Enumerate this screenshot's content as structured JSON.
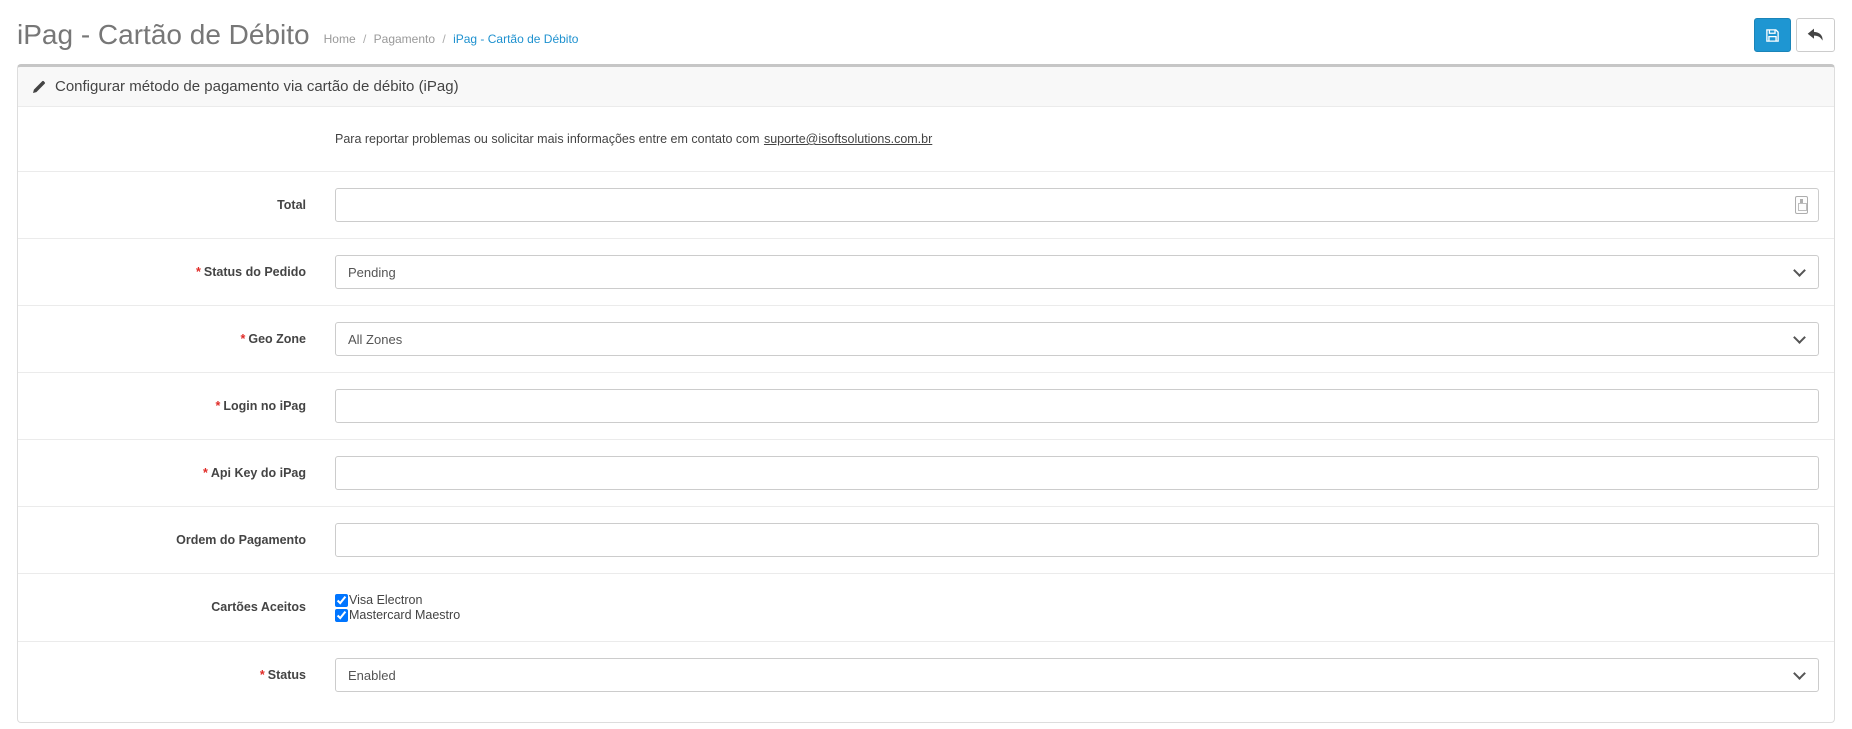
{
  "page": {
    "title": "iPag - Cartão de Débito"
  },
  "breadcrumb": {
    "separator": "/",
    "items": [
      "Home",
      "Pagamento",
      "iPag - Cartão de Débito"
    ]
  },
  "toolbar": {
    "buttons": [
      {
        "name": "save",
        "icon": "save-floppy-icon"
      },
      {
        "name": "back",
        "icon": "back-arrow-icon"
      }
    ]
  },
  "panel": {
    "heading_icon": "pencil-icon",
    "heading": "Configurar método de pagamento via cartão de débito (iPag)",
    "contact": {
      "text": "Para reportar problemas ou solicitar mais informações entre em contato com",
      "email": "suporte@isoftsolutions.com.br"
    },
    "rows": [
      {
        "label": "Total",
        "required": false,
        "type": "text",
        "value": "",
        "trailing_icon": "autofill-icon"
      },
      {
        "label": "Status do Pedido",
        "required": true,
        "type": "select",
        "value": "Pending"
      },
      {
        "label": "Geo Zone",
        "required": true,
        "type": "select",
        "value": "All Zones"
      },
      {
        "label": "Login no iPag",
        "required": true,
        "type": "text",
        "value": ""
      },
      {
        "label": "Api Key do iPag",
        "required": true,
        "type": "text",
        "value": ""
      },
      {
        "label": "Ordem do Pagamento",
        "required": false,
        "type": "text",
        "value": ""
      },
      {
        "label": "Cartões Aceitos",
        "required": false,
        "type": "checkbox-group",
        "options": [
          {
            "label": "Visa Electron",
            "checked": true
          },
          {
            "label": "Mastercard Maestro",
            "checked": true
          }
        ]
      },
      {
        "label": "Status",
        "required": true,
        "type": "select",
        "value": "Enabled"
      }
    ]
  },
  "ui": {
    "required_marker": "*"
  },
  "colors": {
    "accent_blue": "#1e96d2",
    "breadcrumb_active": "#1e91cf",
    "breadcrumb_muted": "#999999",
    "required_red": "#e02b27",
    "title_gray": "#777777",
    "panel_border": "#dddddd",
    "row_separator": "#ebebeb",
    "heading_bg": "#f8f8f8"
  }
}
